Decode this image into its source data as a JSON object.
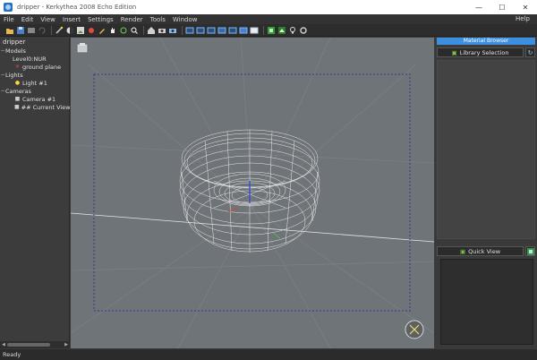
{
  "window": {
    "title": "dripper - Kerkythea 2008 Echo Edition",
    "minimize": "—",
    "maximize": "☐",
    "close": "✕"
  },
  "menu": {
    "items": [
      "File",
      "Edit",
      "View",
      "Insert",
      "Settings",
      "Render",
      "Tools",
      "Window"
    ],
    "help": "Help"
  },
  "tree": {
    "root": "dripper",
    "models": "Models",
    "model_item": "Level0:NUR",
    "ground": "ground plane",
    "lights": "Lights",
    "light_item": "Light #1",
    "cameras": "Cameras",
    "camera_item": "Camera #1",
    "current_view": "## Current View"
  },
  "right_panel": {
    "header": "Material Browser",
    "library_button": "Library Selection",
    "quick_view_button": "Quick View"
  },
  "status": {
    "text": "Ready"
  },
  "colors": {
    "accent": "#3d8fe0",
    "viewport_bg": "#6f7479",
    "safe_frame": "#2a3d8f"
  }
}
